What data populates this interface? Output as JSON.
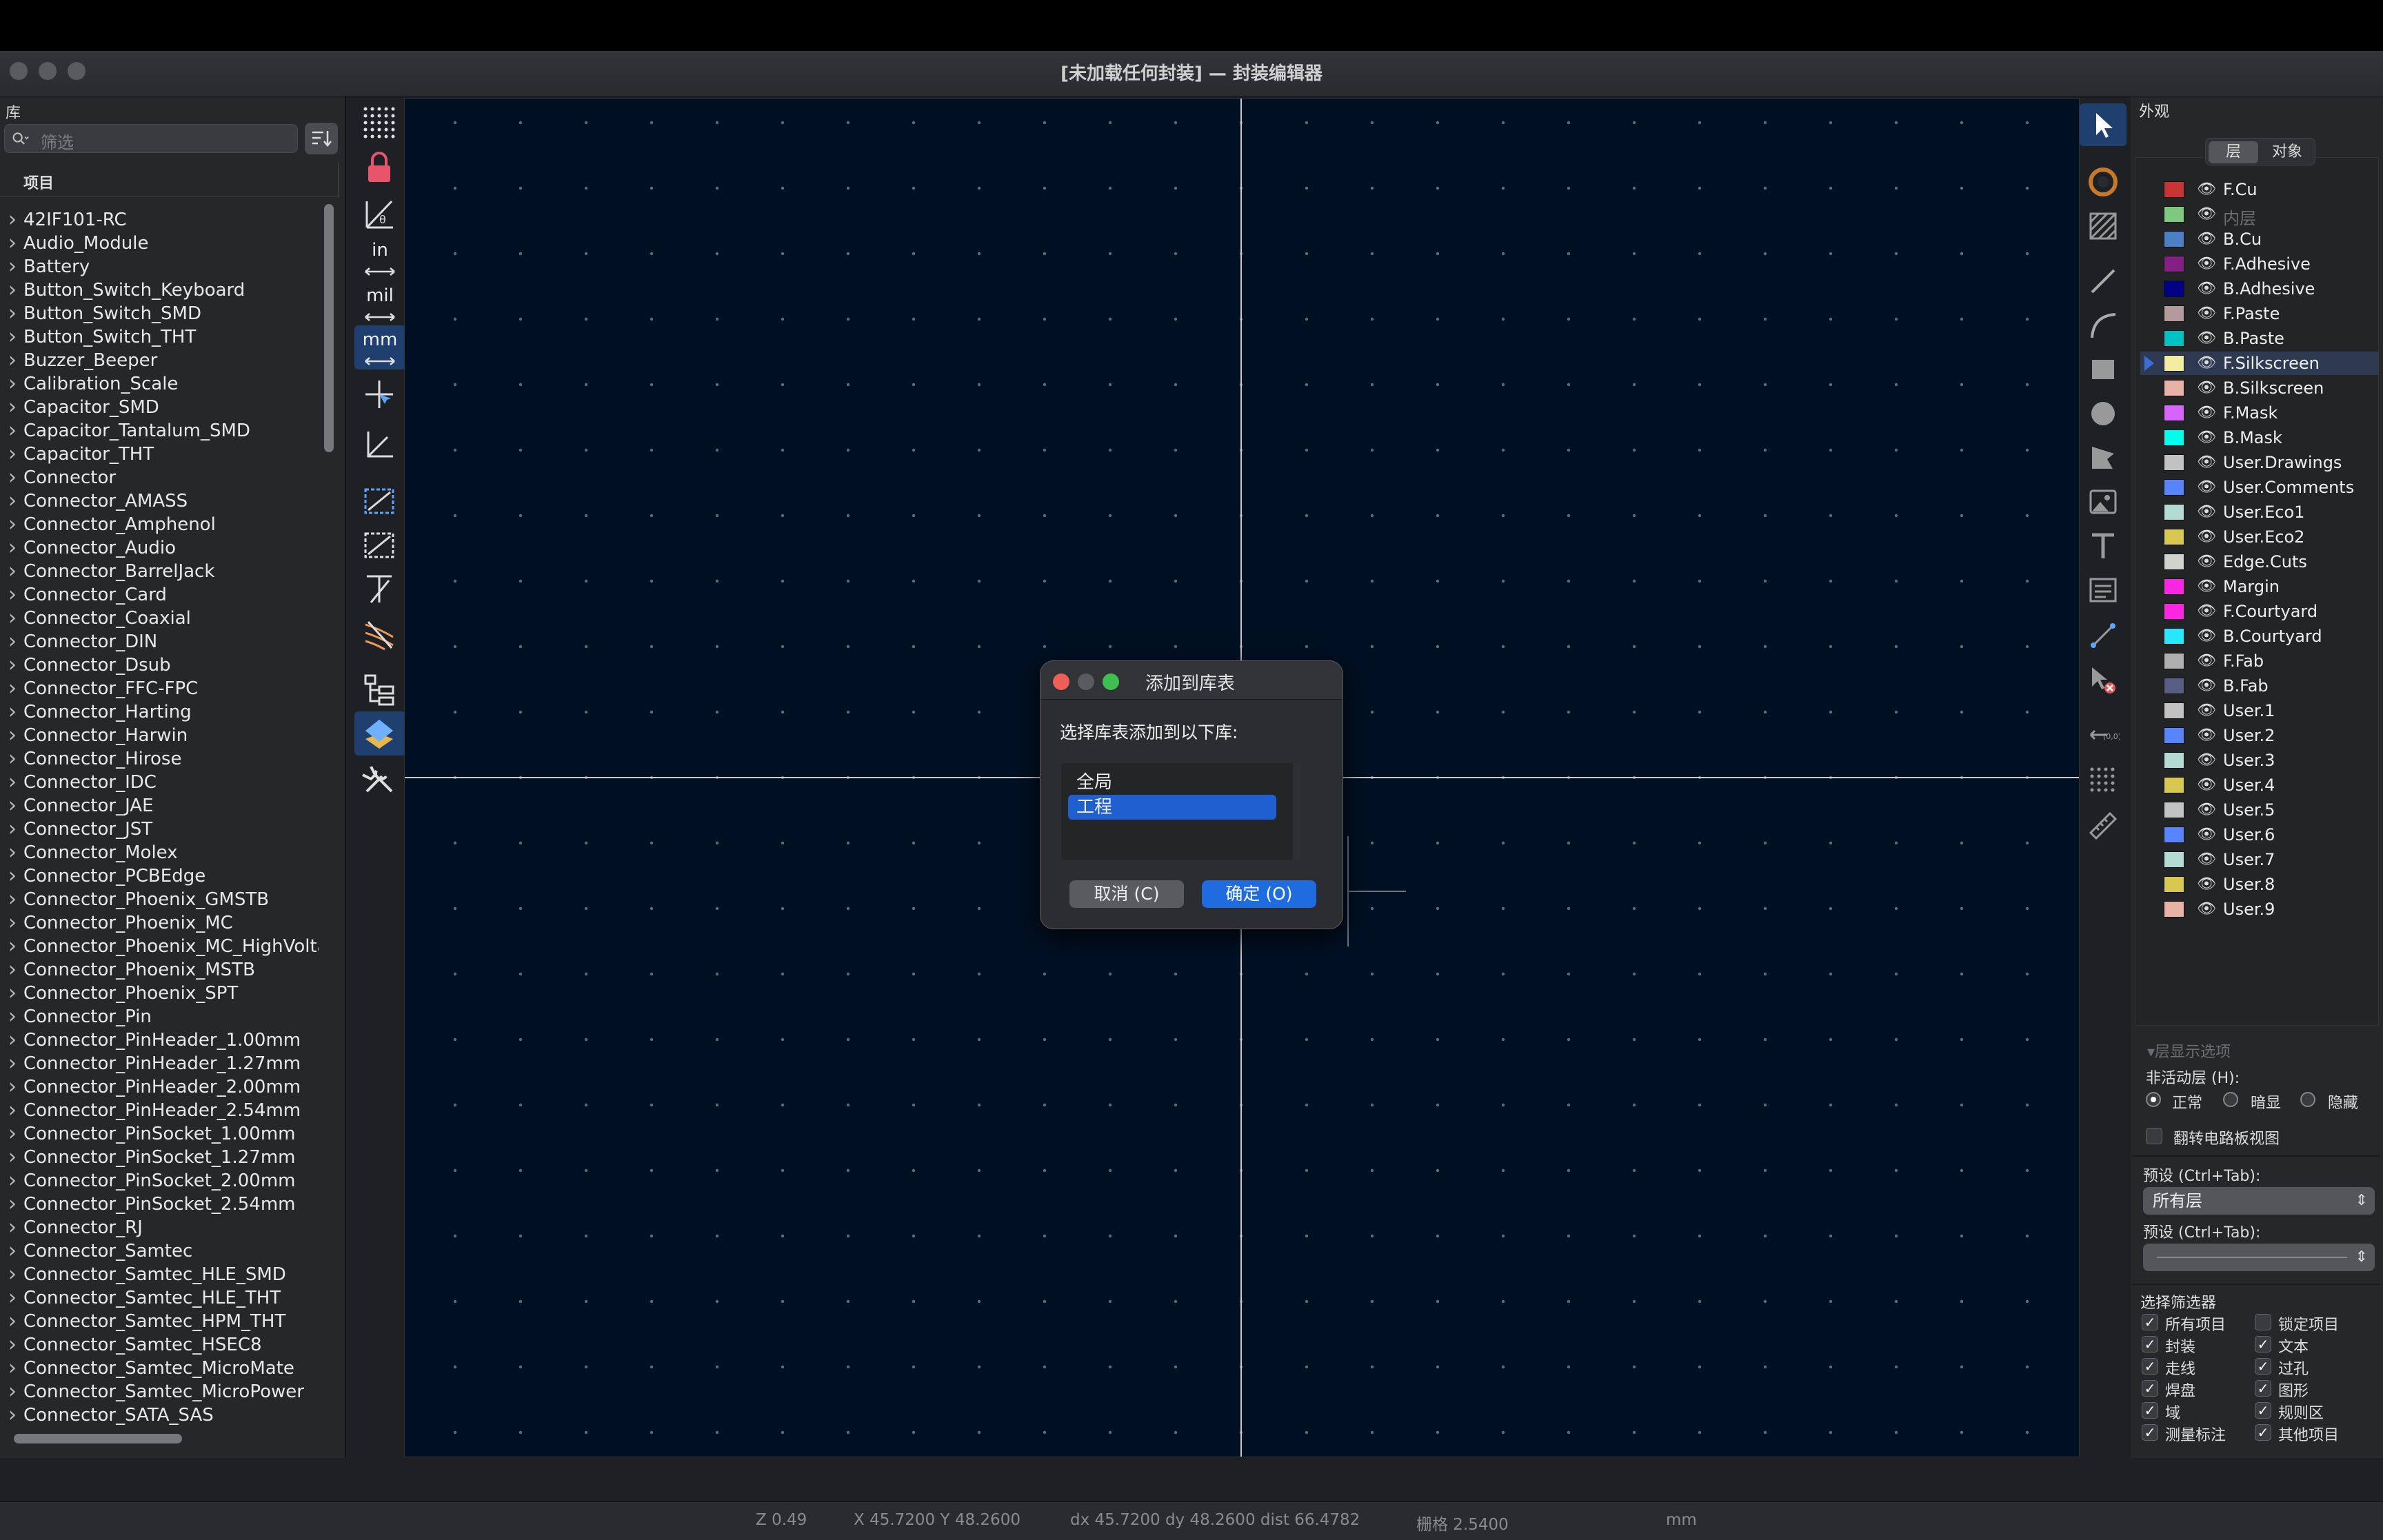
{
  "window": {
    "title": "[未加载任何封装] — 封装编辑器"
  },
  "library": {
    "title": "库",
    "search_placeholder": "筛选",
    "column_header": "项目",
    "items": [
      "42IF101-RC",
      "Audio_Module",
      "Battery",
      "Button_Switch_Keyboard",
      "Button_Switch_SMD",
      "Button_Switch_THT",
      "Buzzer_Beeper",
      "Calibration_Scale",
      "Capacitor_SMD",
      "Capacitor_Tantalum_SMD",
      "Capacitor_THT",
      "Connector",
      "Connector_AMASS",
      "Connector_Amphenol",
      "Connector_Audio",
      "Connector_BarrelJack",
      "Connector_Card",
      "Connector_Coaxial",
      "Connector_DIN",
      "Connector_Dsub",
      "Connector_FFC-FPC",
      "Connector_Harting",
      "Connector_Harwin",
      "Connector_Hirose",
      "Connector_IDC",
      "Connector_JAE",
      "Connector_JST",
      "Connector_Molex",
      "Connector_PCBEdge",
      "Connector_Phoenix_GMSTB",
      "Connector_Phoenix_MC",
      "Connector_Phoenix_MC_HighVoltage",
      "Connector_Phoenix_MSTB",
      "Connector_Phoenix_SPT",
      "Connector_Pin",
      "Connector_PinHeader_1.00mm",
      "Connector_PinHeader_1.27mm",
      "Connector_PinHeader_2.00mm",
      "Connector_PinHeader_2.54mm",
      "Connector_PinSocket_1.00mm",
      "Connector_PinSocket_1.27mm",
      "Connector_PinSocket_2.00mm",
      "Connector_PinSocket_2.54mm",
      "Connector_RJ",
      "Connector_Samtec",
      "Connector_Samtec_HLE_SMD",
      "Connector_Samtec_HLE_THT",
      "Connector_Samtec_HPM_THT",
      "Connector_Samtec_HSEC8",
      "Connector_Samtec_MicroMate",
      "Connector_Samtec_MicroPower",
      "Connector_SATA_SAS"
    ]
  },
  "left_toolbar": {
    "unit_in": "in",
    "unit_mil": "mil",
    "unit_mm": "mm"
  },
  "appearance": {
    "title": "外观",
    "tab_layers": "层",
    "tab_objects": "对象",
    "layers": [
      {
        "name": "F.Cu",
        "color": "#c83434"
      },
      {
        "name": "内层",
        "color": "#7fc87f",
        "dim": true
      },
      {
        "name": "B.Cu",
        "color": "#4d7fc4"
      },
      {
        "name": "F.Adhesive",
        "color": "#841f84"
      },
      {
        "name": "B.Adhesive",
        "color": "#000084"
      },
      {
        "name": "F.Paste",
        "color": "#b49a9a"
      },
      {
        "name": "B.Paste",
        "color": "#00c2c2"
      },
      {
        "name": "F.Silkscreen",
        "color": "#f2eda1",
        "highlight": true
      },
      {
        "name": "B.Silkscreen",
        "color": "#e8b2a7"
      },
      {
        "name": "F.Mask",
        "color": "#d864ff"
      },
      {
        "name": "B.Mask",
        "color": "#02ffee"
      },
      {
        "name": "User.Drawings",
        "color": "#c2c2c2"
      },
      {
        "name": "User.Comments",
        "color": "#5984ff"
      },
      {
        "name": "User.Eco1",
        "color": "#b4dbd2"
      },
      {
        "name": "User.Eco2",
        "color": "#d8c852"
      },
      {
        "name": "Edge.Cuts",
        "color": "#d0d2cd"
      },
      {
        "name": "Margin",
        "color": "#ff26e2"
      },
      {
        "name": "F.Courtyard",
        "color": "#ff26e2"
      },
      {
        "name": "B.Courtyard",
        "color": "#26e9ff"
      },
      {
        "name": "F.Fab",
        "color": "#afafaf"
      },
      {
        "name": "B.Fab",
        "color": "#585d84"
      },
      {
        "name": "User.1",
        "color": "#c2c2c2"
      },
      {
        "name": "User.2",
        "color": "#5984ff"
      },
      {
        "name": "User.3",
        "color": "#b4dbd2"
      },
      {
        "name": "User.4",
        "color": "#d8c852"
      },
      {
        "name": "User.5",
        "color": "#c2c2c2"
      },
      {
        "name": "User.6",
        "color": "#5984ff"
      },
      {
        "name": "User.7",
        "color": "#b4dbd2"
      },
      {
        "name": "User.8",
        "color": "#d8c852"
      },
      {
        "name": "User.9",
        "color": "#e8b2a7"
      }
    ],
    "layer_display_options": "▾层显示选项",
    "inactive_layers_label": "非活动层 (H):",
    "inactive_options": [
      "正常",
      "暗显",
      "隐藏"
    ],
    "flip_board": "翻转电路板视图",
    "preset_label": "预设 (Ctrl+Tab):",
    "preset_value": "所有层",
    "preset_label2": "预设 (Ctrl+Tab):",
    "selection_filter_title": "选择筛选器",
    "filters_left": [
      {
        "label": "所有项目",
        "checked": true
      },
      {
        "label": "封装",
        "checked": true
      },
      {
        "label": "走线",
        "checked": true
      },
      {
        "label": "焊盘",
        "checked": true
      },
      {
        "label": "域",
        "checked": true
      },
      {
        "label": "测量标注",
        "checked": true
      }
    ],
    "filters_right": [
      {
        "label": "锁定项目",
        "checked": false
      },
      {
        "label": "文本",
        "checked": true
      },
      {
        "label": "过孔",
        "checked": true
      },
      {
        "label": "图形",
        "checked": true
      },
      {
        "label": "规则区",
        "checked": true
      },
      {
        "label": "其他项目",
        "checked": true
      }
    ]
  },
  "dialog": {
    "title": "添加到库表",
    "prompt": "选择库表添加到以下库:",
    "options": [
      "全局",
      "工程"
    ],
    "selected": "工程",
    "cancel": "取消 (C)",
    "ok": "确定 (O)"
  },
  "status": {
    "zoom": "Z 0.49",
    "xy": "X 45.7200  Y 48.2600",
    "delta": "dx 45.7200  dy 48.2600  dist 66.4782",
    "grid": "栅格 2.5400",
    "units": "mm"
  }
}
